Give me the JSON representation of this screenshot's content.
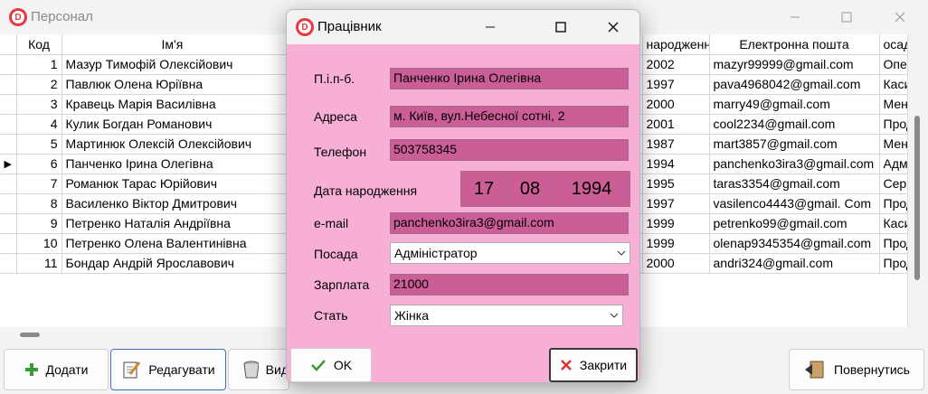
{
  "main_window": {
    "title": "Персонал",
    "grid": {
      "columns": [
        "Код",
        "Ім'я",
        "народження",
        "Електронна пошта",
        "осада"
      ],
      "rows": [
        {
          "code": "1",
          "name": "Мазур Тимофій Олексійович",
          "birth": "2002",
          "email": "mazyr99999@gmail.com",
          "position": "Опер"
        },
        {
          "code": "2",
          "name": "Павлюк Олена Юріївна",
          "birth": "1997",
          "email": "pava4968042@gmail.com",
          "position": "Каси"
        },
        {
          "code": "3",
          "name": "Кравець Марія Василівна",
          "birth": "2000",
          "email": "marry49@gmail.com",
          "position": "Мене"
        },
        {
          "code": "4",
          "name": "Кулик Богдан Романович",
          "birth": "2001",
          "email": "cool2234@gmail.com",
          "position": "Прод"
        },
        {
          "code": "5",
          "name": "Мартинюк Олексій Олексійович",
          "birth": "1987",
          "email": "mart3857@gmail.com",
          "position": "Мене"
        },
        {
          "code": "6",
          "name": "Панченко Ірина Олегівна",
          "birth": "1994",
          "email": "panchenko3ira3@gmail.com",
          "position": "Адмі"
        },
        {
          "code": "7",
          "name": "Романюк Тарас Юрійович",
          "birth": "1995",
          "email": "taras3354@gmail.com",
          "position": "Серв"
        },
        {
          "code": "8",
          "name": "Василенко Віктор Дмитрович",
          "birth": "1997",
          "email": "vasilenco4443@gmail. Com",
          "position": "Прод"
        },
        {
          "code": "9",
          "name": "Петренко Наталія Андріївна",
          "birth": "1999",
          "email": "petrenko99@gmail.com",
          "position": "Каси"
        },
        {
          "code": "10",
          "name": "Петренко Олена Валентинівна",
          "birth": "1999",
          "email": "olenap9345354@gmail.com",
          "position": "Прод"
        },
        {
          "code": "11",
          "name": "Бондар Андрій Ярославович",
          "birth": "2000",
          "email": "andri324@gmail.com",
          "position": "Прод"
        }
      ]
    },
    "buttons": {
      "add": "Додати",
      "edit": "Редагувати",
      "delete": "Вид",
      "back": "Повернутись"
    }
  },
  "dialog": {
    "title": "Працівник",
    "labels": {
      "fullname": "П.і.п-б.",
      "address": "Адреса",
      "phone": "Телефон",
      "birthdate": "Дата народження",
      "email": "e-mail",
      "position": "Посада",
      "salary": "Зарплата",
      "gender": "Стать"
    },
    "values": {
      "fullname": "Панченко Ірина Олегівна",
      "address": "м. Київ, вул.Небесної сотні, 2",
      "phone": "503758345",
      "birth_day": "17",
      "birth_month": "08",
      "birth_year": "1994",
      "email": "panchenko3ira3@gmail.com",
      "position": "Адміністратор",
      "salary": "21000",
      "gender": "Жінка"
    },
    "buttons": {
      "ok": "OK",
      "close": "Закрити"
    }
  },
  "colors": {
    "dialog_bg": "#f7afd5",
    "field_bg": "#cb5d97",
    "app_icon": "#e8383d"
  }
}
